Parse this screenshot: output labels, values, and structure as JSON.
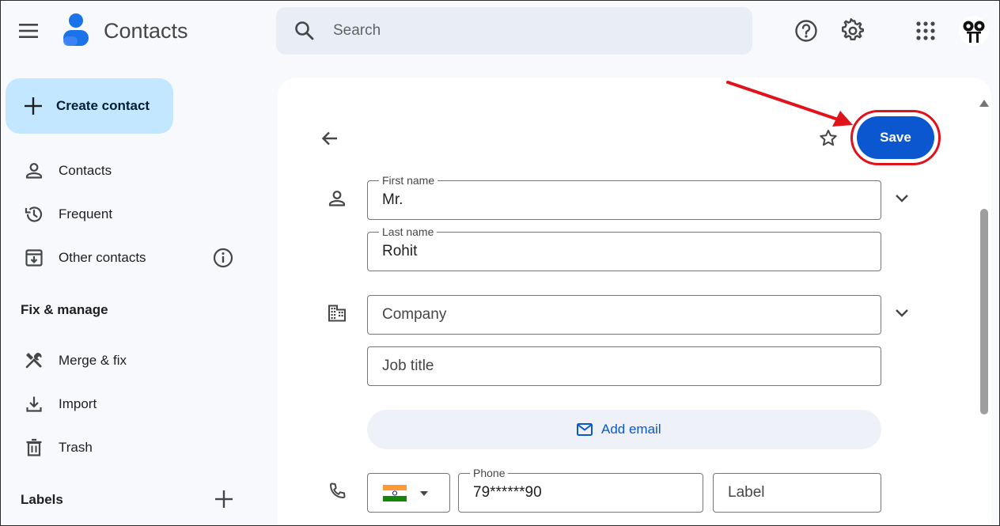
{
  "header": {
    "app_title": "Contacts",
    "search_placeholder": "Search",
    "icons": [
      "menu-icon",
      "contacts-logo",
      "search-icon",
      "help-icon",
      "gear-icon",
      "apps-grid-icon",
      "avatar"
    ]
  },
  "sidebar": {
    "create_label": "Create contact",
    "items": [
      {
        "label": "Contacts",
        "icon": "person-icon"
      },
      {
        "label": "Frequent",
        "icon": "history-icon"
      },
      {
        "label": "Other contacts",
        "icon": "archive-download-icon"
      }
    ],
    "fix_manage_heading": "Fix & manage",
    "fix_items": [
      {
        "label": "Merge & fix",
        "icon": "tools-icon"
      },
      {
        "label": "Import",
        "icon": "download-icon"
      },
      {
        "label": "Trash",
        "icon": "trash-icon"
      }
    ],
    "labels_heading": "Labels"
  },
  "form": {
    "save_label": "Save",
    "first_name": {
      "label": "First name",
      "value": "Mr."
    },
    "last_name": {
      "label": "Last name",
      "value": "Rohit"
    },
    "company": {
      "placeholder": "Company"
    },
    "job_title": {
      "placeholder": "Job title"
    },
    "add_email_label": "Add email",
    "phone": {
      "label": "Phone",
      "value": "79******90",
      "country_flag": "India"
    },
    "phone_label_field": {
      "placeholder": "Label"
    }
  },
  "colors": {
    "primary": "#0b57d0",
    "create_button_bg": "#c2e7ff",
    "annotation_red": "#e0121a"
  }
}
